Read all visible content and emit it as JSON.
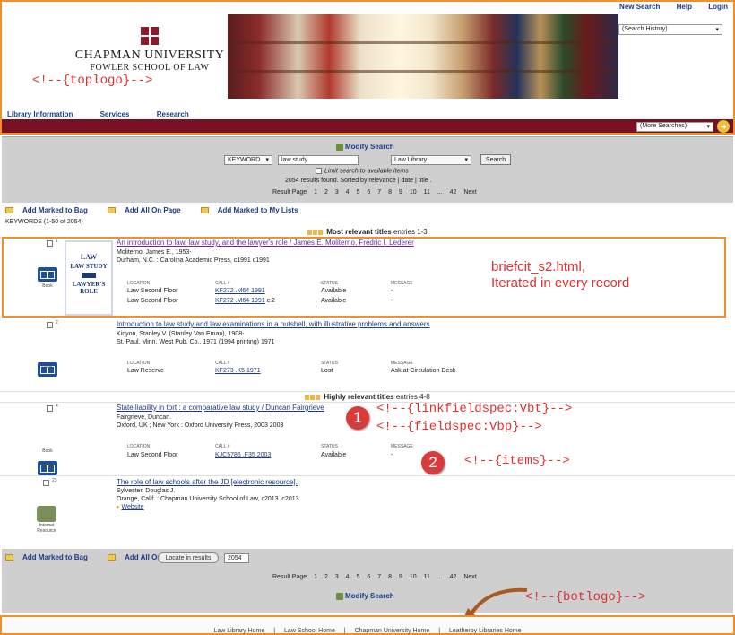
{
  "header": {
    "links": [
      "New Search",
      "Help",
      "Login"
    ],
    "history_select": "(Search History)",
    "logo_line1": "CHAPMAN UNIVERSITY",
    "logo_line2": "FOWLER SCHOOL OF LAW",
    "nav": [
      "Library Information",
      "Services",
      "Research"
    ],
    "more_searches": "(More Searches)",
    "toplogo_note": "<!--{toplogo}-->"
  },
  "search": {
    "modify": "Modify Search",
    "type": "KEYWORD",
    "term": "law study",
    "scope": "Law Library",
    "button": "Search",
    "limit": "Limit search to available items",
    "found": "2054 results found. Sorted by relevance | date | title .",
    "pager_label": "Result Page",
    "pages": [
      "1",
      "2",
      "3",
      "4",
      "5",
      "6",
      "7",
      "8",
      "9",
      "10",
      "11",
      "...",
      "42",
      "Next"
    ]
  },
  "toolbar": {
    "add_bag": "Add Marked to Bag",
    "add_all": "Add All On Page",
    "add_lists": "Add Marked to My Lists",
    "keywords": "KEYWORDS (1-50 of 2054)"
  },
  "bands": {
    "most_relevant": "Most relevant titles",
    "most_entries": "entries 1-3",
    "highly_relevant": "Highly relevant titles",
    "highly_entries": "entries 4-8"
  },
  "table_headers": [
    "LOCATION",
    "CALL #",
    "STATUS",
    "MESSAGE"
  ],
  "records": [
    {
      "num": "1",
      "format": "Book",
      "title": "An introduction to law, law study, and the lawyer's role / James E. Moliterno, Fredric I. Lederer",
      "author": "Moliterno, James E., 1953-",
      "pub": "Durham, N.C. : Carolina Academic Press, c1991 c1991",
      "items": [
        {
          "loc": "Law Second Floor",
          "call": "KF272 .M64 1991",
          "extra": "",
          "status": "Available",
          "msg": "-"
        },
        {
          "loc": "Law Second Floor",
          "call": "KF272 .M64 1991",
          "extra": "c.2",
          "status": "Available",
          "msg": "-"
        }
      ],
      "cover": [
        "LAW",
        "LAW STUDY",
        "LAWYER'S ROLE"
      ]
    },
    {
      "num": "2",
      "format": "Book",
      "title": "Introduction to law study and law examinations in a nutshell, with illustrative problems and answers",
      "author": "Kinyon, Stanley V. (Stanley Van Eman), 1908-",
      "pub": "St. Paul, Minn. West Pub. Co., 1971 (1994 printing) 1971",
      "items": [
        {
          "loc": "Law Reserve",
          "call": "KF273 .K5 1971",
          "extra": "",
          "status": "Lost",
          "msg": "Ask at Circulation Desk"
        }
      ]
    },
    {
      "num": "4",
      "format": "Book",
      "title": "State liability in tort : a comparative law study / Duncan Fairgrieve",
      "author": "Fairgrieve, Duncan.",
      "pub": "Oxford, UK ; New York : Oxford University Press, 2003 2003",
      "items": [
        {
          "loc": "Law Second Floor",
          "call": "KJC5786 .F35 2003",
          "extra": "",
          "status": "Available",
          "msg": "-"
        }
      ]
    },
    {
      "num": "23",
      "format": "Internet Resource",
      "title": "The role of law schools after the JD [electronic resource].",
      "author": "Sylvester, Douglas J.",
      "pub": "Orange, Calif. : Chapman University School of Law, c2013. c2013",
      "website": "Website"
    }
  ],
  "annotations": {
    "briefcit1": "briefcit_s2.html,",
    "briefcit2": "Iterated in every record",
    "n1": "1",
    "n2": "2",
    "linkfield": "<!--{linkfieldspec:Vbt}-->",
    "fieldspec": "<!--{fieldspec:Vbp}-->",
    "items": "<!--{items}-->",
    "botlogo": "<!--{botlogo}-->"
  },
  "bottom": {
    "locate": "Locate in results",
    "locate_value": "2054",
    "footer": [
      "Law Library Home",
      "|",
      "Law School Home",
      "|",
      "Chapman University Home",
      "|",
      "Leatherby Libraries Home"
    ]
  }
}
